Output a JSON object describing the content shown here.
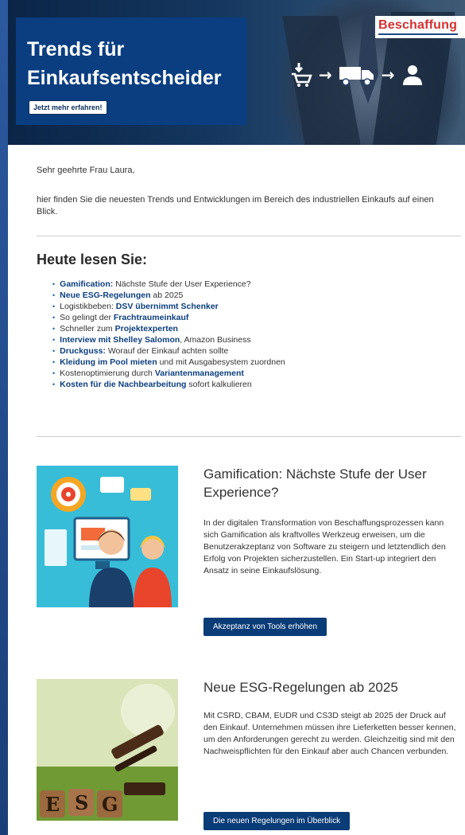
{
  "hero": {
    "title_line1": "Trends für",
    "title_line2": "Einkaufsentscheider",
    "cta_label": "Jetzt mehr erfahren!",
    "brand": "Beschaffung"
  },
  "greeting": "Sehr geehrte Frau Laura,",
  "intro": "hier finden Sie die neuesten Trends und Entwicklungen im Bereich des industriellen Einkaufs auf einen Blick.",
  "toc": {
    "title": "Heute lesen Sie:",
    "items": [
      {
        "pre": "",
        "link": "Gamification:",
        "post": " Nächste Stufe der User Experience?"
      },
      {
        "pre": "",
        "link": "Neue ESG-Regelungen",
        "post": " ab 2025"
      },
      {
        "pre": "Logistikbeben: ",
        "link": "DSV übernimmt Schenker",
        "post": ""
      },
      {
        "pre": "So gelingt der ",
        "link": "Frachtraumeinkauf",
        "post": ""
      },
      {
        "pre": "Schneller zum ",
        "link": "Projektexperten",
        "post": ""
      },
      {
        "pre": "",
        "link": "Interview mit Shelley Salomon",
        "post": ", Amazon Business"
      },
      {
        "pre": "",
        "link": "Druckguss:",
        "post": " Worauf der Einkauf achten sollte"
      },
      {
        "pre": "",
        "link": "Kleidung im Pool mieten",
        "post": " und mit Ausgabesystem zuordnen"
      },
      {
        "pre": "Kostenoptimierung durch ",
        "link": "Variantenmanagement",
        "post": ""
      },
      {
        "pre": "",
        "link": "Kosten für die Nachbearbeitung",
        "post": " sofort kalkulieren"
      }
    ]
  },
  "articles": [
    {
      "title": "Gamification: Nächste Stufe der User Experience?",
      "text": "In der digitalen Transformation von Beschaffungsprozessen kann sich Gamification als kraftvolles Werkzeug erweisen, um die Benutzerakzeptanz von Software zu steigern und letztendlich den Erfolg von Projekten sicherzustellen. Ein Start-up integriert den Ansatz in seine Einkaufslösung.",
      "button": "Akzeptanz von Tools erhöhen"
    },
    {
      "title": "Neue ESG-Regelungen ab 2025",
      "text": "Mit CSRD, CBAM, EUDR und CS3D steigt ab 2025 der Druck auf den Einkauf. Unternehmen müssen ihre Lieferketten besser kennen, um den Anforderungen gerecht zu werden. Gleichzeitig sind mit den Nachweispflichten für den Einkauf aber auch Chancen verbunden.",
      "button": "Die neuen Regelungen im Überblick",
      "image_letters": [
        "E",
        "S",
        "G"
      ]
    }
  ],
  "colors": {
    "accent": "#0a3c77",
    "link": "#0c3f7f",
    "brand_red": "#d23131",
    "page_frame": "#1d4a86"
  }
}
